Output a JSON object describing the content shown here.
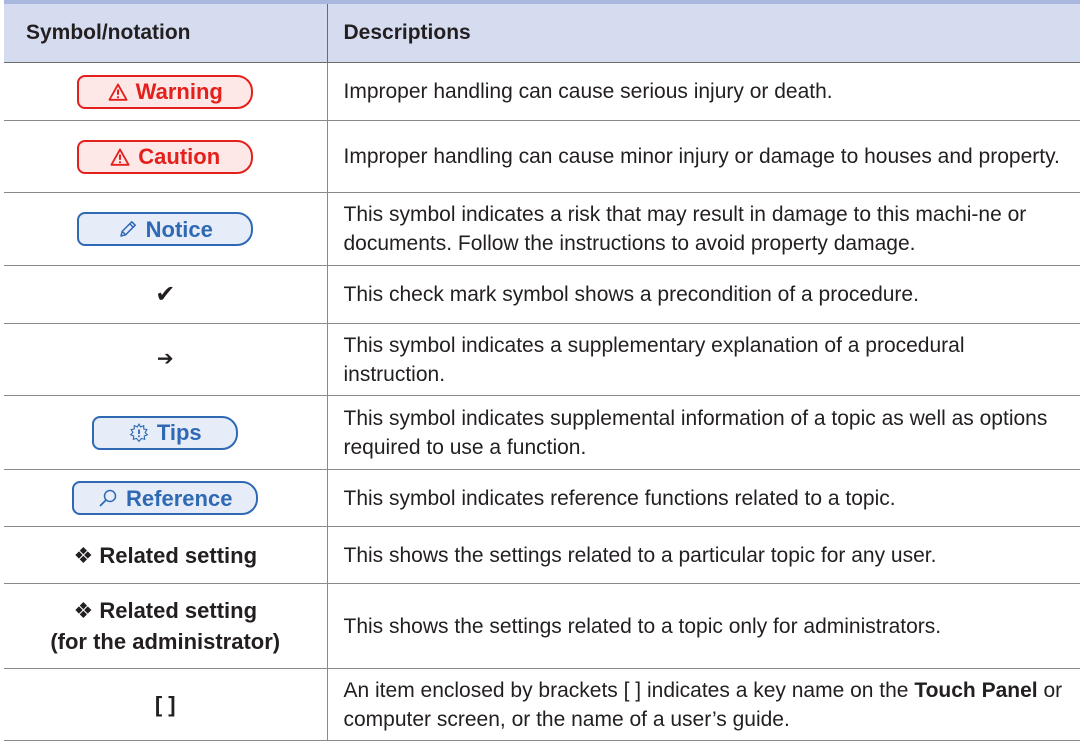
{
  "table": {
    "headers": [
      "Symbol/notation",
      "Descriptions"
    ],
    "rows": [
      {
        "symbol": "Warning",
        "description": "Improper handling can cause serious injury or death."
      },
      {
        "symbol": "Caution",
        "description": "Improper handling can cause minor injury or damage to houses and property."
      },
      {
        "symbol": "Notice",
        "description": "This symbol indicates a risk that may result in damage to this machi-ne or documents. Follow the instructions to avoid property damage."
      },
      {
        "symbol": "✔",
        "description": "This check mark symbol shows a precondition of a procedure."
      },
      {
        "symbol": "➔",
        "description": "This symbol indicates a supplementary explanation of a procedural instruction."
      },
      {
        "symbol": "Tips",
        "description": "This symbol indicates supplemental information of a topic as well as options required to use a function."
      },
      {
        "symbol": "Reference",
        "description": "This symbol indicates reference functions related to a topic."
      },
      {
        "symbol": "Related setting",
        "description": "This shows the settings related to a particular topic for any user."
      },
      {
        "symbol": "Related setting",
        "symbol_line2": "(for the administrator)",
        "description": "This shows the settings related to a topic only for administrators."
      },
      {
        "symbol": "[ ]",
        "description_before": "An item enclosed by brackets [ ] indicates a key name on the ",
        "description_bold": "Touch Panel",
        "description_after": " or computer screen, or the name of a user’s guide."
      }
    ]
  },
  "decor": {
    "diamond": "❖"
  },
  "colors": {
    "header_bg": "#d6dcef",
    "top_bar": "#a9b6dd",
    "warning_red": "#e3201b",
    "info_blue": "#2f69b3"
  }
}
